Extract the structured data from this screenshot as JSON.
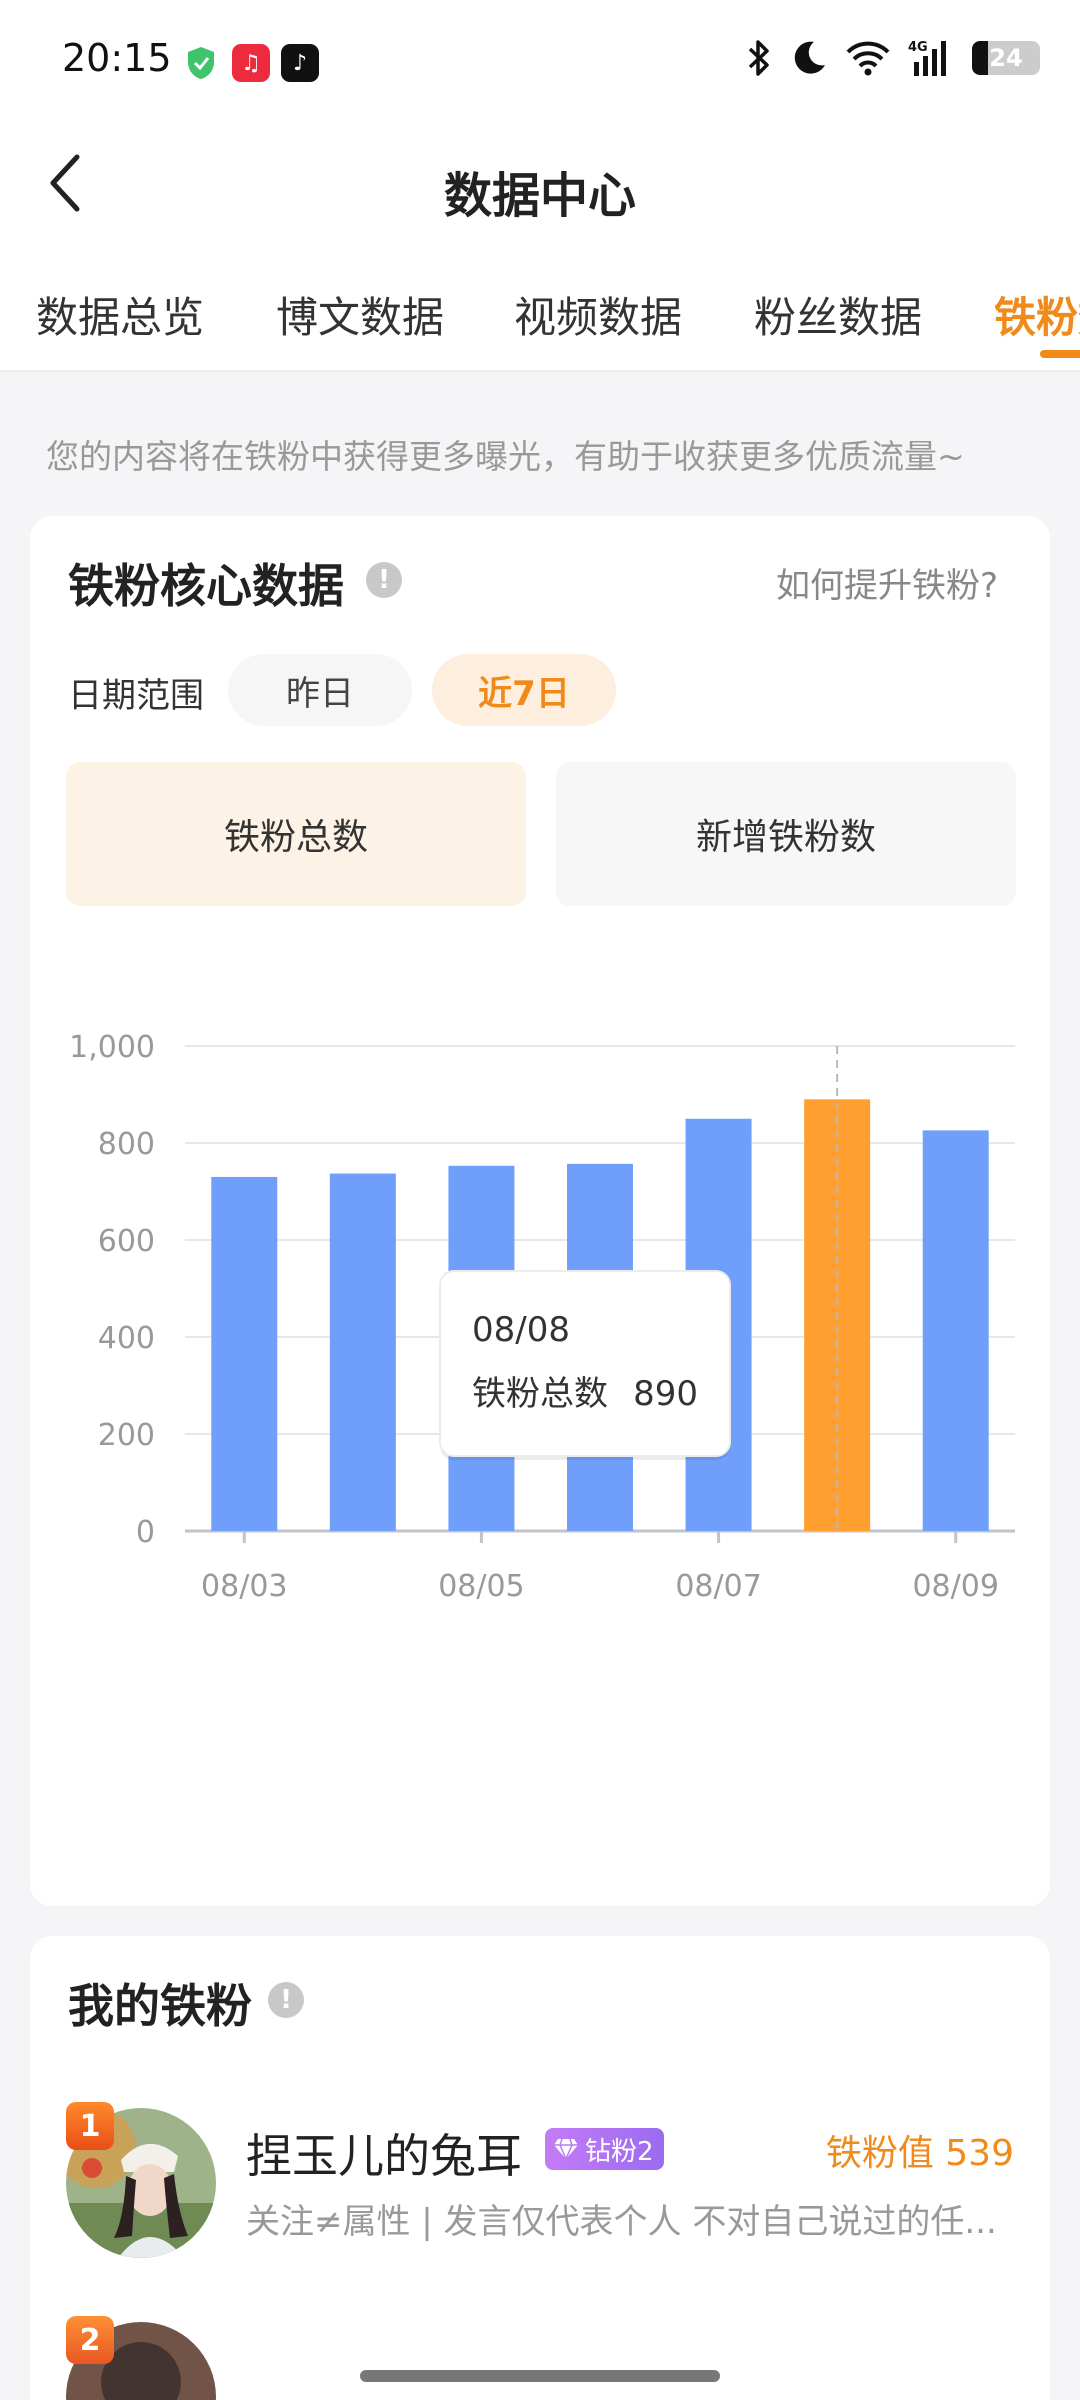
{
  "status_bar": {
    "time": "20:15",
    "battery": "24",
    "network": "4G"
  },
  "header": {
    "title": "数据中心"
  },
  "tabs": [
    {
      "label": "数据总览"
    },
    {
      "label": "博文数据"
    },
    {
      "label": "视频数据"
    },
    {
      "label": "粉丝数据"
    },
    {
      "label": "铁粉数"
    }
  ],
  "active_tab": "铁粉数",
  "notice": "您的内容将在铁粉中获得更多曝光，有助于收获更多优质流量~",
  "core": {
    "title": "铁粉核心数据",
    "help_link": "如何提升铁粉?",
    "date_label": "日期范围",
    "range_yesterday": "昨日",
    "range_7d": "近7日",
    "selected_range": "近7日",
    "metric_total": "铁粉总数",
    "metric_new": "新增铁粉数",
    "selected_metric": "铁粉总数"
  },
  "chart_data": {
    "type": "bar",
    "categories": [
      "08/03",
      "08/04",
      "08/05",
      "08/06",
      "08/07",
      "08/08",
      "08/09"
    ],
    "series": [
      {
        "name": "铁粉总数",
        "values": [
          730,
          737,
          753,
          757,
          850,
          890,
          826
        ]
      }
    ],
    "ylim": [
      0,
      1000
    ],
    "yticks": [
      "0",
      "200",
      "400",
      "600",
      "800",
      "1,000"
    ],
    "xtick_labels": [
      "08/03",
      "08/05",
      "08/07",
      "08/09"
    ],
    "highlight_index": 5,
    "tooltip": {
      "date": "08/08",
      "label": "铁粉总数",
      "value": "890"
    },
    "colors": {
      "bar": "#6f9ffb",
      "highlight": "#ff9f30",
      "grid": "#e6e8ee",
      "axis": "#bfc3cb",
      "tick": "#999999"
    },
    "grid": true
  },
  "fans": {
    "title": "我的铁粉",
    "items": [
      {
        "rank": "1",
        "name": "捏玉儿的兔耳",
        "level": "钻粉2",
        "value": "铁粉值 539",
        "bio": "关注≠属性 | 发言仅代表个人 不对自己说过的任..."
      }
    ]
  }
}
